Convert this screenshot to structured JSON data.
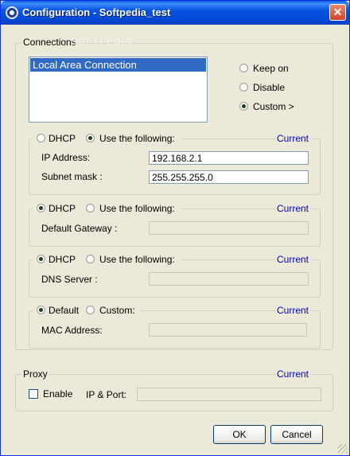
{
  "window": {
    "title": "Configuration - Softpedia_test",
    "close_glyph": "✕",
    "watermark": "SOFTPEDIA"
  },
  "connections": {
    "label": "Connections",
    "list_items": [
      "Local Area Connection"
    ],
    "mode_options": [
      "Keep on",
      "Disable",
      "Custom >"
    ],
    "selected_mode": "Custom >"
  },
  "ip_group": {
    "opt_dhcp": "DHCP",
    "opt_static": "Use the following:",
    "selected": "static",
    "current": "Current",
    "ip_label": "IP Address:",
    "ip_value": "192.168.2.1",
    "mask_label": "Subnet mask :",
    "mask_value": "255.255.255.0"
  },
  "gateway_group": {
    "opt_dhcp": "DHCP",
    "opt_static": "Use the following:",
    "selected": "dhcp",
    "current": "Current",
    "gateway_label": "Default Gateway :",
    "gateway_value": ""
  },
  "dns_group": {
    "opt_dhcp": "DHCP",
    "opt_static": "Use the following:",
    "selected": "dhcp",
    "current": "Current",
    "dns_label": "DNS Server :",
    "dns_value": ""
  },
  "mac_group": {
    "opt_default": "Default",
    "opt_custom": "Custom:",
    "selected": "default",
    "current": "Current",
    "mac_label": "MAC Address:",
    "mac_value": ""
  },
  "proxy": {
    "label": "Proxy",
    "current": "Current",
    "enable_label": "Enable",
    "enabled": false,
    "ipport_label": "IP & Port:",
    "ipport_value": ""
  },
  "buttons": {
    "ok": "OK",
    "cancel": "Cancel"
  },
  "colors": {
    "titlebar": "#0654e4",
    "current_link": "#0000cc",
    "selection": "#316ac5",
    "dialog_bg": "#ece9d8"
  }
}
